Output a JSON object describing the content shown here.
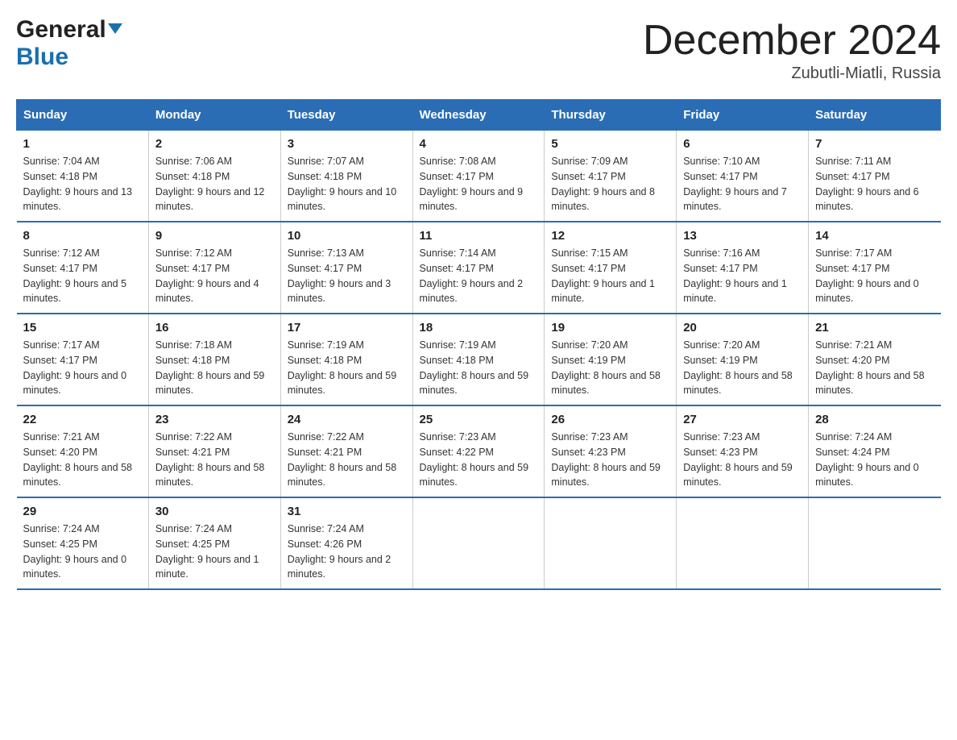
{
  "header": {
    "logo_general": "General",
    "logo_blue": "Blue",
    "month_title": "December 2024",
    "location": "Zubutli-Miatli, Russia"
  },
  "days_of_week": [
    "Sunday",
    "Monday",
    "Tuesday",
    "Wednesday",
    "Thursday",
    "Friday",
    "Saturday"
  ],
  "weeks": [
    [
      {
        "day": "1",
        "sunrise": "Sunrise: 7:04 AM",
        "sunset": "Sunset: 4:18 PM",
        "daylight": "Daylight: 9 hours and 13 minutes."
      },
      {
        "day": "2",
        "sunrise": "Sunrise: 7:06 AM",
        "sunset": "Sunset: 4:18 PM",
        "daylight": "Daylight: 9 hours and 12 minutes."
      },
      {
        "day": "3",
        "sunrise": "Sunrise: 7:07 AM",
        "sunset": "Sunset: 4:18 PM",
        "daylight": "Daylight: 9 hours and 10 minutes."
      },
      {
        "day": "4",
        "sunrise": "Sunrise: 7:08 AM",
        "sunset": "Sunset: 4:17 PM",
        "daylight": "Daylight: 9 hours and 9 minutes."
      },
      {
        "day": "5",
        "sunrise": "Sunrise: 7:09 AM",
        "sunset": "Sunset: 4:17 PM",
        "daylight": "Daylight: 9 hours and 8 minutes."
      },
      {
        "day": "6",
        "sunrise": "Sunrise: 7:10 AM",
        "sunset": "Sunset: 4:17 PM",
        "daylight": "Daylight: 9 hours and 7 minutes."
      },
      {
        "day": "7",
        "sunrise": "Sunrise: 7:11 AM",
        "sunset": "Sunset: 4:17 PM",
        "daylight": "Daylight: 9 hours and 6 minutes."
      }
    ],
    [
      {
        "day": "8",
        "sunrise": "Sunrise: 7:12 AM",
        "sunset": "Sunset: 4:17 PM",
        "daylight": "Daylight: 9 hours and 5 minutes."
      },
      {
        "day": "9",
        "sunrise": "Sunrise: 7:12 AM",
        "sunset": "Sunset: 4:17 PM",
        "daylight": "Daylight: 9 hours and 4 minutes."
      },
      {
        "day": "10",
        "sunrise": "Sunrise: 7:13 AM",
        "sunset": "Sunset: 4:17 PM",
        "daylight": "Daylight: 9 hours and 3 minutes."
      },
      {
        "day": "11",
        "sunrise": "Sunrise: 7:14 AM",
        "sunset": "Sunset: 4:17 PM",
        "daylight": "Daylight: 9 hours and 2 minutes."
      },
      {
        "day": "12",
        "sunrise": "Sunrise: 7:15 AM",
        "sunset": "Sunset: 4:17 PM",
        "daylight": "Daylight: 9 hours and 1 minute."
      },
      {
        "day": "13",
        "sunrise": "Sunrise: 7:16 AM",
        "sunset": "Sunset: 4:17 PM",
        "daylight": "Daylight: 9 hours and 1 minute."
      },
      {
        "day": "14",
        "sunrise": "Sunrise: 7:17 AM",
        "sunset": "Sunset: 4:17 PM",
        "daylight": "Daylight: 9 hours and 0 minutes."
      }
    ],
    [
      {
        "day": "15",
        "sunrise": "Sunrise: 7:17 AM",
        "sunset": "Sunset: 4:17 PM",
        "daylight": "Daylight: 9 hours and 0 minutes."
      },
      {
        "day": "16",
        "sunrise": "Sunrise: 7:18 AM",
        "sunset": "Sunset: 4:18 PM",
        "daylight": "Daylight: 8 hours and 59 minutes."
      },
      {
        "day": "17",
        "sunrise": "Sunrise: 7:19 AM",
        "sunset": "Sunset: 4:18 PM",
        "daylight": "Daylight: 8 hours and 59 minutes."
      },
      {
        "day": "18",
        "sunrise": "Sunrise: 7:19 AM",
        "sunset": "Sunset: 4:18 PM",
        "daylight": "Daylight: 8 hours and 59 minutes."
      },
      {
        "day": "19",
        "sunrise": "Sunrise: 7:20 AM",
        "sunset": "Sunset: 4:19 PM",
        "daylight": "Daylight: 8 hours and 58 minutes."
      },
      {
        "day": "20",
        "sunrise": "Sunrise: 7:20 AM",
        "sunset": "Sunset: 4:19 PM",
        "daylight": "Daylight: 8 hours and 58 minutes."
      },
      {
        "day": "21",
        "sunrise": "Sunrise: 7:21 AM",
        "sunset": "Sunset: 4:20 PM",
        "daylight": "Daylight: 8 hours and 58 minutes."
      }
    ],
    [
      {
        "day": "22",
        "sunrise": "Sunrise: 7:21 AM",
        "sunset": "Sunset: 4:20 PM",
        "daylight": "Daylight: 8 hours and 58 minutes."
      },
      {
        "day": "23",
        "sunrise": "Sunrise: 7:22 AM",
        "sunset": "Sunset: 4:21 PM",
        "daylight": "Daylight: 8 hours and 58 minutes."
      },
      {
        "day": "24",
        "sunrise": "Sunrise: 7:22 AM",
        "sunset": "Sunset: 4:21 PM",
        "daylight": "Daylight: 8 hours and 58 minutes."
      },
      {
        "day": "25",
        "sunrise": "Sunrise: 7:23 AM",
        "sunset": "Sunset: 4:22 PM",
        "daylight": "Daylight: 8 hours and 59 minutes."
      },
      {
        "day": "26",
        "sunrise": "Sunrise: 7:23 AM",
        "sunset": "Sunset: 4:23 PM",
        "daylight": "Daylight: 8 hours and 59 minutes."
      },
      {
        "day": "27",
        "sunrise": "Sunrise: 7:23 AM",
        "sunset": "Sunset: 4:23 PM",
        "daylight": "Daylight: 8 hours and 59 minutes."
      },
      {
        "day": "28",
        "sunrise": "Sunrise: 7:24 AM",
        "sunset": "Sunset: 4:24 PM",
        "daylight": "Daylight: 9 hours and 0 minutes."
      }
    ],
    [
      {
        "day": "29",
        "sunrise": "Sunrise: 7:24 AM",
        "sunset": "Sunset: 4:25 PM",
        "daylight": "Daylight: 9 hours and 0 minutes."
      },
      {
        "day": "30",
        "sunrise": "Sunrise: 7:24 AM",
        "sunset": "Sunset: 4:25 PM",
        "daylight": "Daylight: 9 hours and 1 minute."
      },
      {
        "day": "31",
        "sunrise": "Sunrise: 7:24 AM",
        "sunset": "Sunset: 4:26 PM",
        "daylight": "Daylight: 9 hours and 2 minutes."
      },
      {
        "day": "",
        "sunrise": "",
        "sunset": "",
        "daylight": ""
      },
      {
        "day": "",
        "sunrise": "",
        "sunset": "",
        "daylight": ""
      },
      {
        "day": "",
        "sunrise": "",
        "sunset": "",
        "daylight": ""
      },
      {
        "day": "",
        "sunrise": "",
        "sunset": "",
        "daylight": ""
      }
    ]
  ]
}
